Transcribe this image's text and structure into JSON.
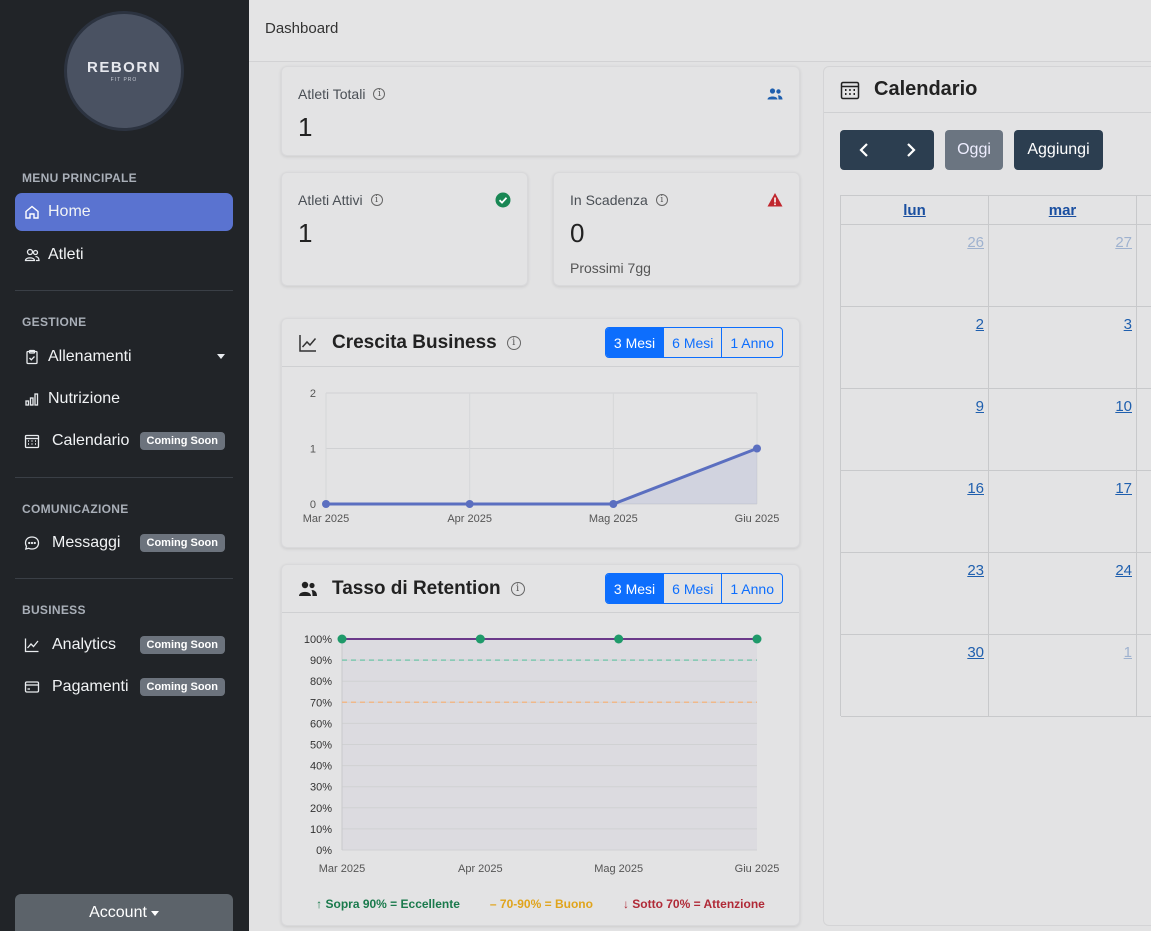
{
  "sidebar": {
    "logo": {
      "line1": "REBORN",
      "line2": "FIT PRO"
    },
    "sections": [
      {
        "title": "MENU PRINCIPALE"
      },
      {
        "title": "GESTIONE"
      },
      {
        "title": "COMUNICAZIONE"
      },
      {
        "title": "BUSINESS"
      }
    ],
    "items": [
      {
        "label": "Home",
        "icon": "home-icon",
        "active": true
      },
      {
        "label": "Atleti",
        "icon": "users-icon"
      },
      {
        "label": "Allenamenti",
        "icon": "clipboard-icon"
      },
      {
        "label": "Nutrizione",
        "icon": "bar-chart-icon"
      },
      {
        "label": "Calendario",
        "icon": "calendar-icon",
        "badge": "Coming Soon"
      },
      {
        "label": "Messaggi",
        "icon": "chat-icon",
        "badge": "Coming Soon"
      },
      {
        "label": "Analytics",
        "icon": "line-chart-icon",
        "badge": "Coming Soon"
      },
      {
        "label": "Pagamenti",
        "icon": "credit-card-icon",
        "badge": "Coming Soon"
      }
    ],
    "account_label": "Account"
  },
  "topbar": {
    "title": "Dashboard"
  },
  "stats": {
    "totali": {
      "label": "Atleti Totali",
      "value": "1"
    },
    "attivi": {
      "label": "Atleti Attivi",
      "value": "1"
    },
    "scadenza": {
      "label": "In Scadenza",
      "value": "0",
      "sub": "Prossimi 7gg"
    }
  },
  "crescita": {
    "title": "Crescita Business",
    "ranges": [
      "3 Mesi",
      "6 Mesi",
      "1 Anno"
    ],
    "selected": "3 Mesi"
  },
  "retention": {
    "title": "Tasso di Retention",
    "ranges": [
      "3 Mesi",
      "6 Mesi",
      "1 Anno"
    ],
    "selected": "3 Mesi",
    "legend": [
      {
        "text": "↑ Sopra 90% = Eccellente",
        "color": "#1a7a4c"
      },
      {
        "text": "– 70-90% = Buono",
        "color": "#e0a41c"
      },
      {
        "text": "↓ Sotto 70% = Attenzione",
        "color": "#b02a37"
      }
    ]
  },
  "chart_data": [
    {
      "type": "area",
      "title": "",
      "x": [
        "Mar 2025",
        "Apr 2025",
        "Mag 2025",
        "Giu 2025"
      ],
      "series": [
        {
          "values": [
            0,
            0,
            0,
            1
          ]
        }
      ],
      "ylim": [
        0,
        2
      ],
      "yticks": [
        "0",
        "1",
        "2"
      ],
      "color": "#5b6fc0",
      "grid": true
    },
    {
      "type": "line",
      "title": "",
      "x": [
        "Mar 2025",
        "Apr 2025",
        "Mag 2025",
        "Giu 2025"
      ],
      "series": [
        {
          "values": [
            100,
            100,
            100,
            100
          ]
        }
      ],
      "ylim": [
        0,
        100
      ],
      "yticks": [
        "0%",
        "10%",
        "20%",
        "30%",
        "40%",
        "50%",
        "60%",
        "70%",
        "80%",
        "90%",
        "100%"
      ],
      "thresholds": [
        {
          "value": 90,
          "color": "#7fc8b0"
        },
        {
          "value": 70,
          "color": "#f0b88a"
        }
      ],
      "color": "#6b3a8a",
      "point_color": "#1f9a6a",
      "grid": true
    }
  ],
  "calendar": {
    "title": "Calendario",
    "today_label": "Oggi",
    "add_label": "Aggiungi",
    "days_of_week": [
      "lun",
      "mar"
    ],
    "weeks": [
      [
        {
          "d": "26",
          "muted": true
        },
        {
          "d": "27",
          "muted": true
        }
      ],
      [
        {
          "d": "2"
        },
        {
          "d": "3"
        }
      ],
      [
        {
          "d": "9"
        },
        {
          "d": "10"
        }
      ],
      [
        {
          "d": "16"
        },
        {
          "d": "17"
        }
      ],
      [
        {
          "d": "23"
        },
        {
          "d": "24"
        }
      ],
      [
        {
          "d": "30"
        },
        {
          "d": "1",
          "muted": true
        }
      ]
    ]
  }
}
